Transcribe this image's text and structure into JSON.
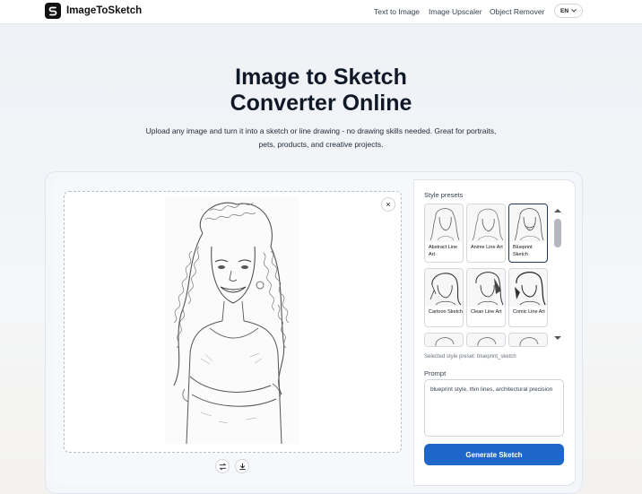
{
  "header": {
    "brand": "ImageToSketch",
    "nav": [
      "Text to Image",
      "Image Upscaler",
      "Object Remover"
    ],
    "language": "EN"
  },
  "hero": {
    "title_line1": "Image to Sketch",
    "title_line2": "Converter Online",
    "subtitle": "Upload any image and turn it into a sketch or line drawing - no drawing skills needed. Great for portraits, pets, products, and creative projects."
  },
  "editor": {
    "close_icon": "×",
    "swap_icon": "swap-icon",
    "download_icon": "download-icon"
  },
  "sidebar": {
    "presets_label": "Style presets",
    "presets": [
      {
        "label": "Abstract Line Art",
        "selected": false
      },
      {
        "label": "Anime Line Art",
        "selected": false
      },
      {
        "label": "Blueprint Sketch",
        "selected": true
      },
      {
        "label": "Cartoon Sketch",
        "selected": false
      },
      {
        "label": "Clean Line Art",
        "selected": false
      },
      {
        "label": "Comic Line Art",
        "selected": false
      }
    ],
    "selected_note": "Selected style preset: blueprint_sketch",
    "prompt_label": "Prompt",
    "prompt_value": "blueprint style, thin lines, architectural precision",
    "generate_label": "Generate Sketch"
  },
  "colors": {
    "accent": "#1e66c9",
    "selected_border": "#1e3a5f"
  }
}
